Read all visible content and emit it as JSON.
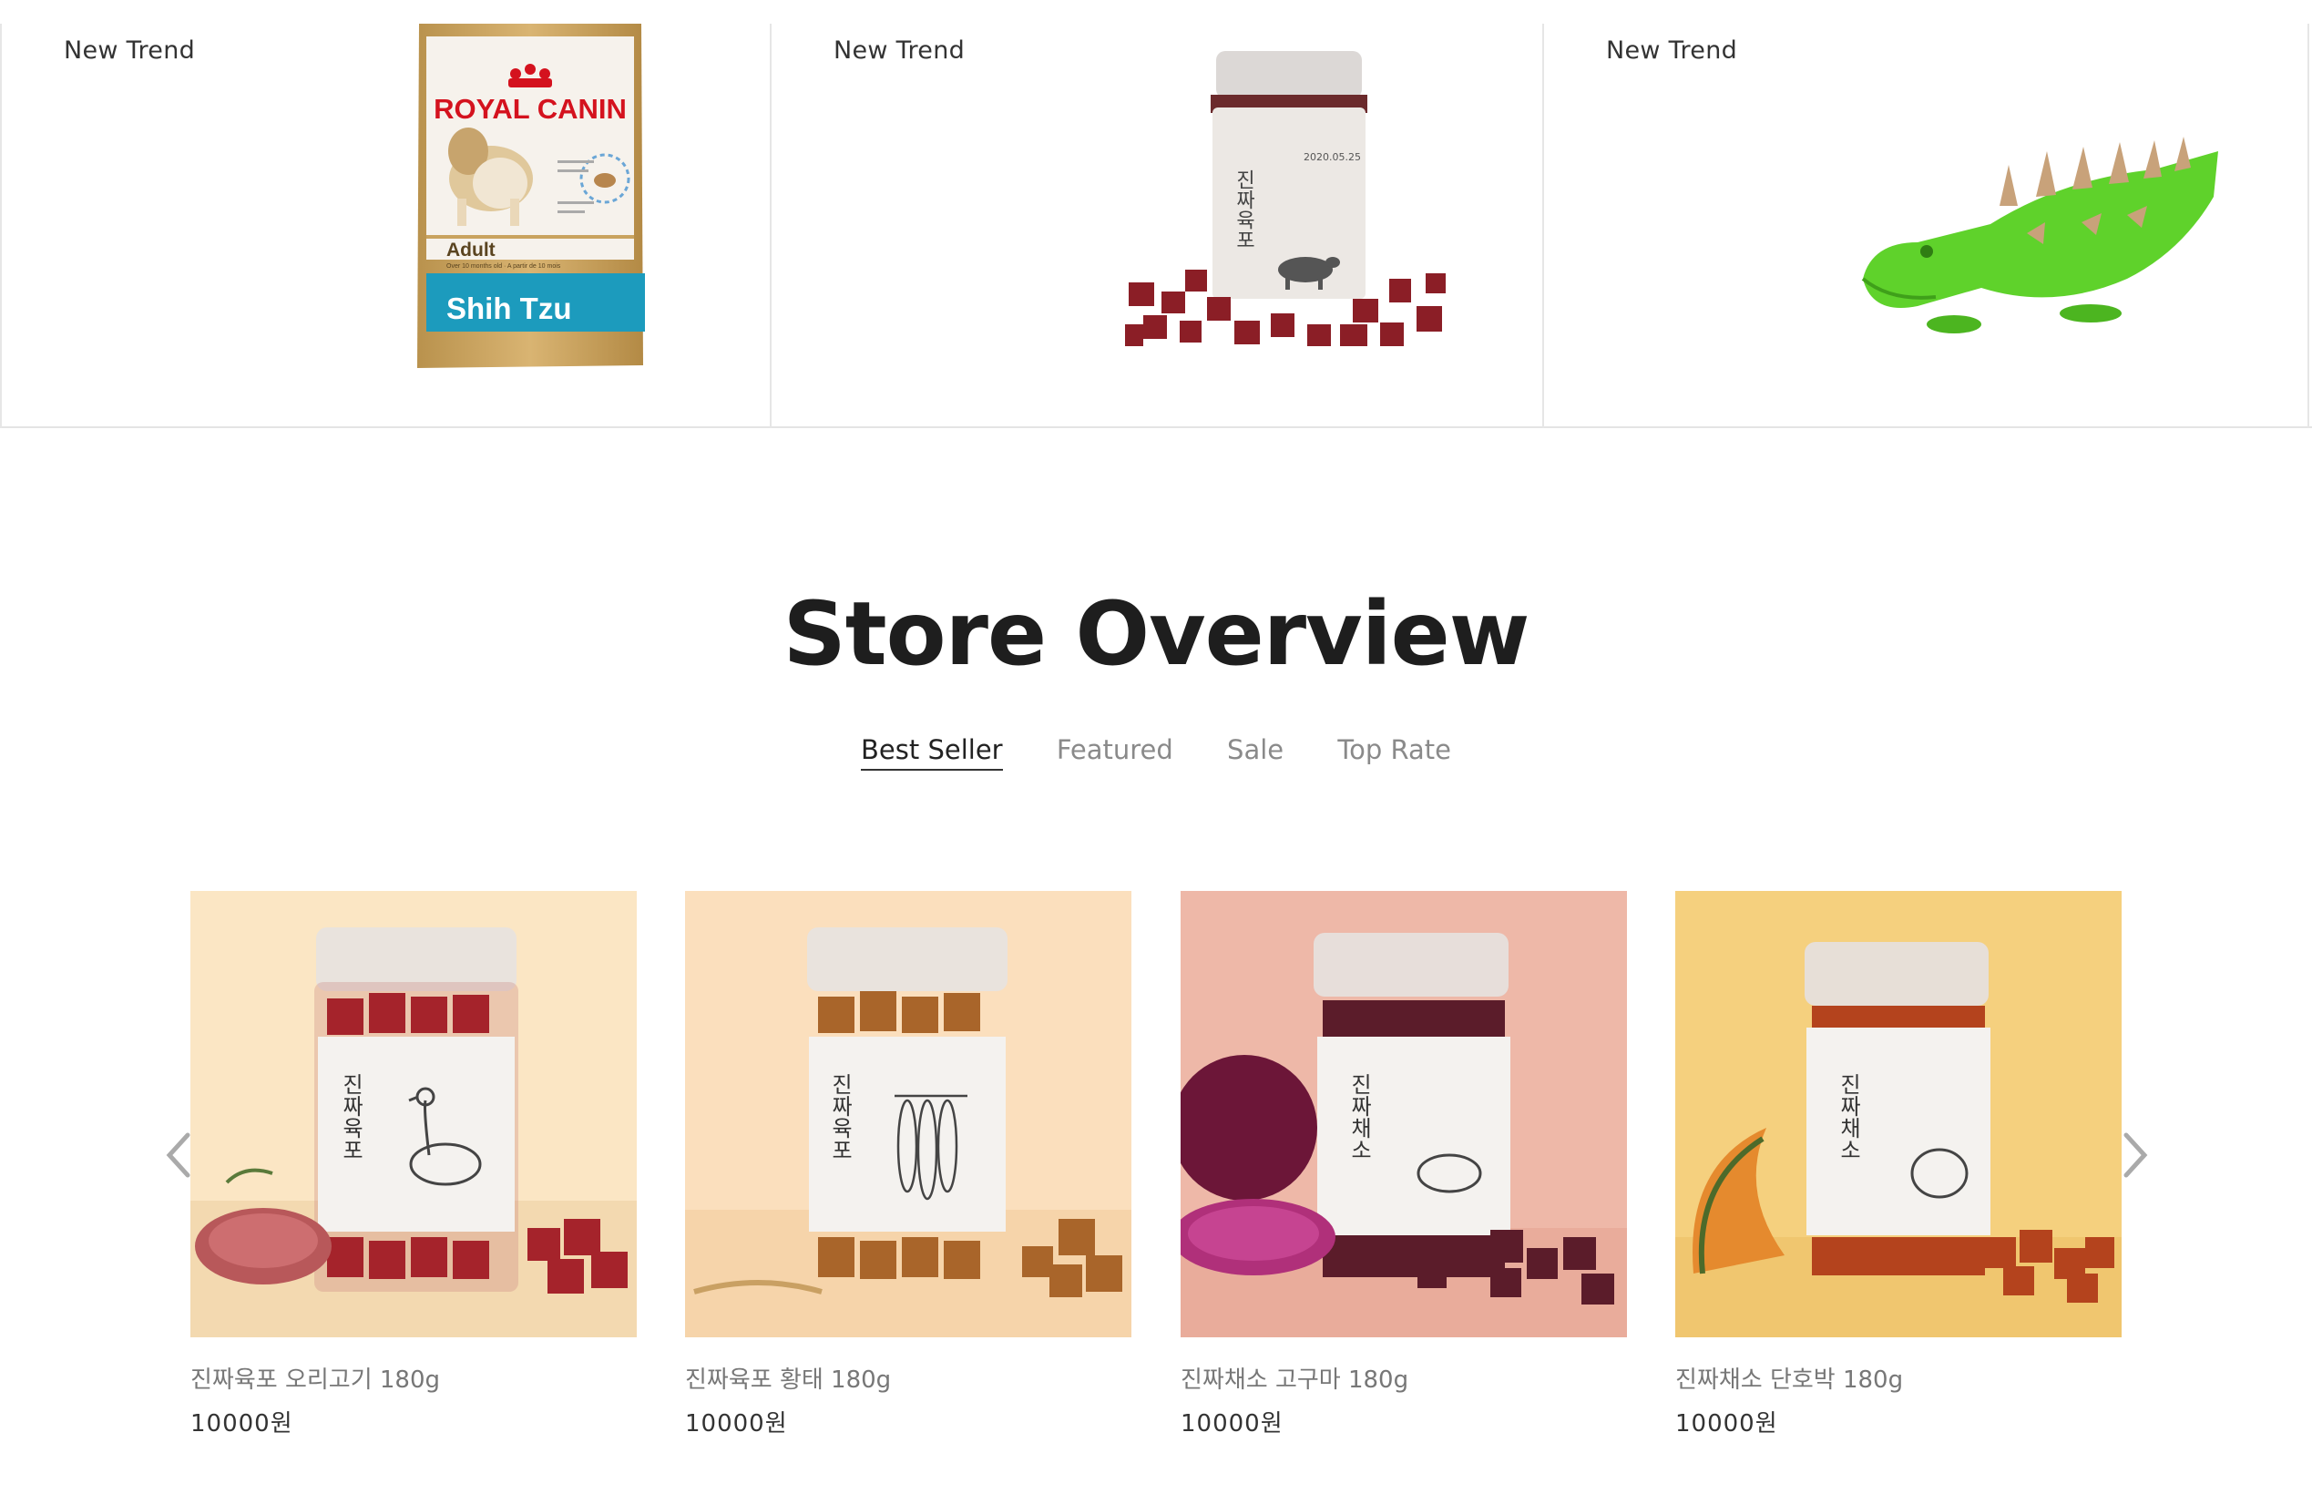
{
  "trend": {
    "cards": [
      {
        "label": "New Trend",
        "product": "ROYAL CANIN Adult Shih Tzu bag",
        "brand": "ROYAL CANIN",
        "bag_line": "Adult",
        "bag_sub": "Over 10 months old · A partir de 10 mois",
        "bag_breed": "Shih Tzu"
      },
      {
        "label": "New Trend",
        "product": "진짜육포 jar with jerky cubes",
        "jar_text": "진짜육포",
        "jar_date": "2020.05.25"
      },
      {
        "label": "New Trend",
        "product": "Green crocodile chew toy"
      }
    ]
  },
  "overview": {
    "title": "Store Overview",
    "tabs": [
      {
        "label": "Best Seller",
        "active": true
      },
      {
        "label": "Featured",
        "active": false
      },
      {
        "label": "Sale",
        "active": false
      },
      {
        "label": "Top Rate",
        "active": false
      }
    ]
  },
  "products": [
    {
      "name": "진짜육포 오리고기 180g",
      "price": "10000원",
      "jar_text": "진짜육포",
      "bg": "#fbe6c4",
      "treat": "#a5232b",
      "art": "duck"
    },
    {
      "name": "진짜육포 황태 180g",
      "price": "10000원",
      "jar_text": "진짜육포",
      "bg": "#fbdfbd",
      "treat": "#a9652a",
      "art": "fish"
    },
    {
      "name": "진짜채소 고구마 180g",
      "price": "10000원",
      "jar_text": "진짜채소",
      "bg": "#eeb8a8",
      "treat": "#5b1c2a",
      "art": "sweet potato"
    },
    {
      "name": "진짜채소 단호박 180g",
      "price": "10000원",
      "jar_text": "진짜채소",
      "bg": "#f5d07e",
      "treat": "#b4431d",
      "art": "pumpkin"
    }
  ],
  "carousel": {
    "prev_icon": "chevron-left-icon",
    "next_icon": "chevron-right-icon"
  }
}
